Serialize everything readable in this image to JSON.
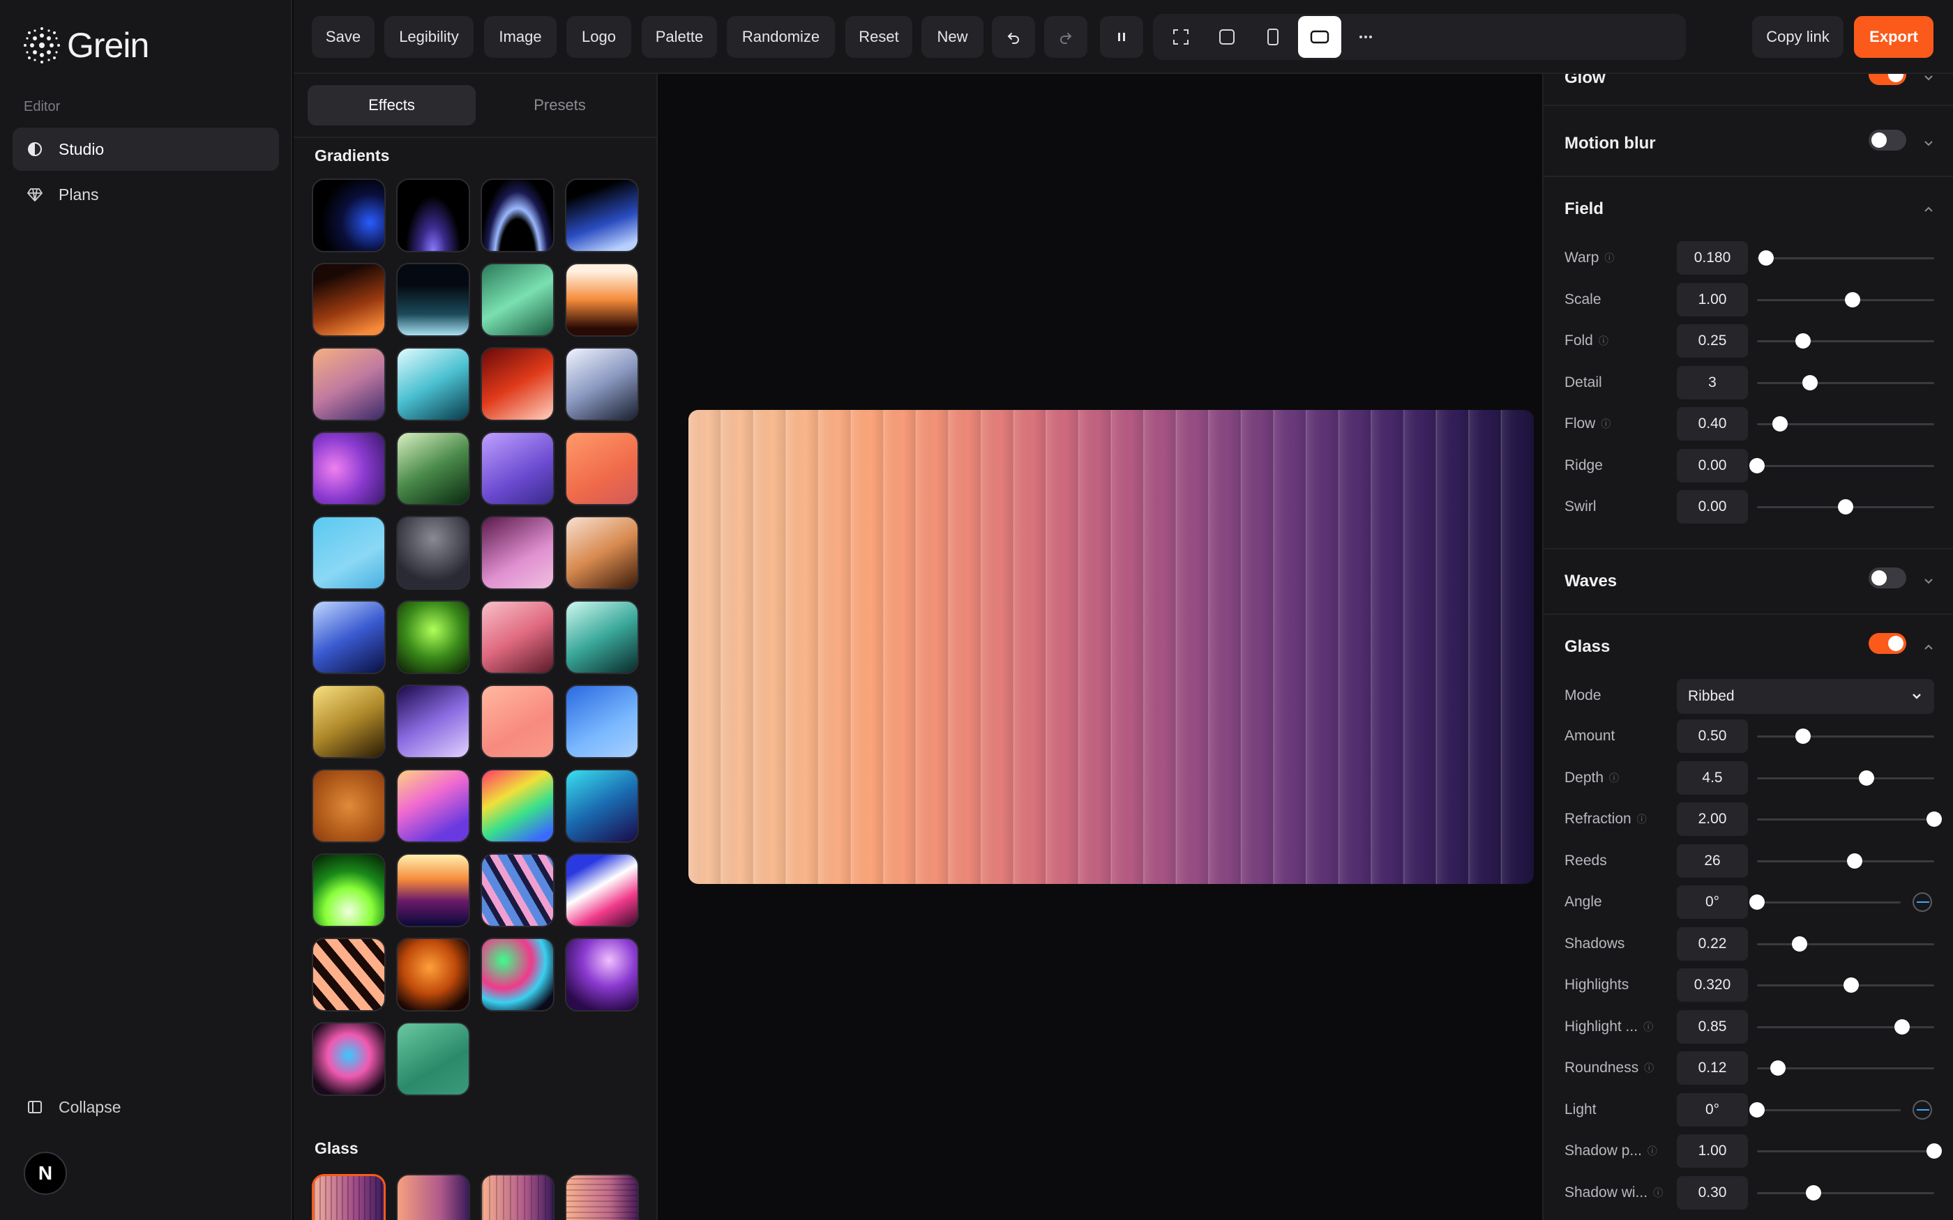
{
  "app": {
    "name": "Grein"
  },
  "sidebar": {
    "section_label": "Editor",
    "items": [
      {
        "label": "Studio",
        "icon": "half-circle-icon",
        "active": true
      },
      {
        "label": "Plans",
        "icon": "diamond-icon",
        "active": false
      }
    ],
    "collapse_label": "Collapse",
    "avatar_letter": "N"
  },
  "toolbar": {
    "buttons": [
      "Save",
      "Legibility",
      "Image",
      "Logo",
      "Palette",
      "Randomize",
      "Reset",
      "New"
    ],
    "icons": [
      "undo-icon",
      "redo-icon",
      "pause-icon",
      "fullscreen-icon",
      "square-frame-icon",
      "portrait-frame-icon",
      "landscape-frame-icon",
      "more-icon"
    ],
    "copy_link_label": "Copy link",
    "export_label": "Export",
    "accent": "#fb5a1a"
  },
  "effects_panel": {
    "tabs": [
      "Effects",
      "Presets"
    ],
    "active_tab": "Effects",
    "gradients_title": "Gradients",
    "glass_title": "Glass"
  },
  "controls": {
    "glow": {
      "title": "Glow",
      "enabled": true
    },
    "motion_blur": {
      "title": "Motion blur",
      "enabled": false
    },
    "field": {
      "title": "Field",
      "rows": [
        {
          "label": "Warp",
          "value": "0.180",
          "pos": 0.05,
          "info": true
        },
        {
          "label": "Scale",
          "value": "1.00",
          "pos": 0.54,
          "info": false
        },
        {
          "label": "Fold",
          "value": "0.25",
          "pos": 0.26,
          "info": true
        },
        {
          "label": "Detail",
          "value": "3",
          "pos": 0.3,
          "info": false
        },
        {
          "label": "Flow",
          "value": "0.40",
          "pos": 0.13,
          "info": true
        },
        {
          "label": "Ridge",
          "value": "0.00",
          "pos": 0.0,
          "info": false
        },
        {
          "label": "Swirl",
          "value": "0.00",
          "pos": 0.5,
          "info": false
        }
      ]
    },
    "waves": {
      "title": "Waves",
      "enabled": false
    },
    "glass": {
      "title": "Glass",
      "enabled": true,
      "mode_label": "Mode",
      "mode_value": "Ribbed",
      "rows": [
        {
          "label": "Amount",
          "value": "0.50",
          "pos": 0.26,
          "info": false
        },
        {
          "label": "Depth",
          "value": "4.5",
          "pos": 0.62,
          "info": true
        },
        {
          "label": "Refraction",
          "value": "2.00",
          "pos": 1.0,
          "info": true
        },
        {
          "label": "Reeds",
          "value": "26",
          "pos": 0.55,
          "info": false
        },
        {
          "label": "Angle",
          "value": "0°",
          "pos": 0.0,
          "info": false,
          "dial": true
        },
        {
          "label": "Shadows",
          "value": "0.22",
          "pos": 0.24,
          "info": false
        },
        {
          "label": "Highlights",
          "value": "0.320",
          "pos": 0.53,
          "info": false
        },
        {
          "label": "Highlight ...",
          "value": "0.85",
          "pos": 0.82,
          "info": true
        },
        {
          "label": "Roundness",
          "value": "0.12",
          "pos": 0.12,
          "info": true
        },
        {
          "label": "Light",
          "value": "0°",
          "pos": 0.0,
          "info": false,
          "dial": true
        },
        {
          "label": "Shadow p...",
          "value": "1.00",
          "pos": 1.0,
          "info": true
        },
        {
          "label": "Shadow wi...",
          "value": "0.30",
          "pos": 0.32,
          "info": true
        }
      ]
    }
  }
}
